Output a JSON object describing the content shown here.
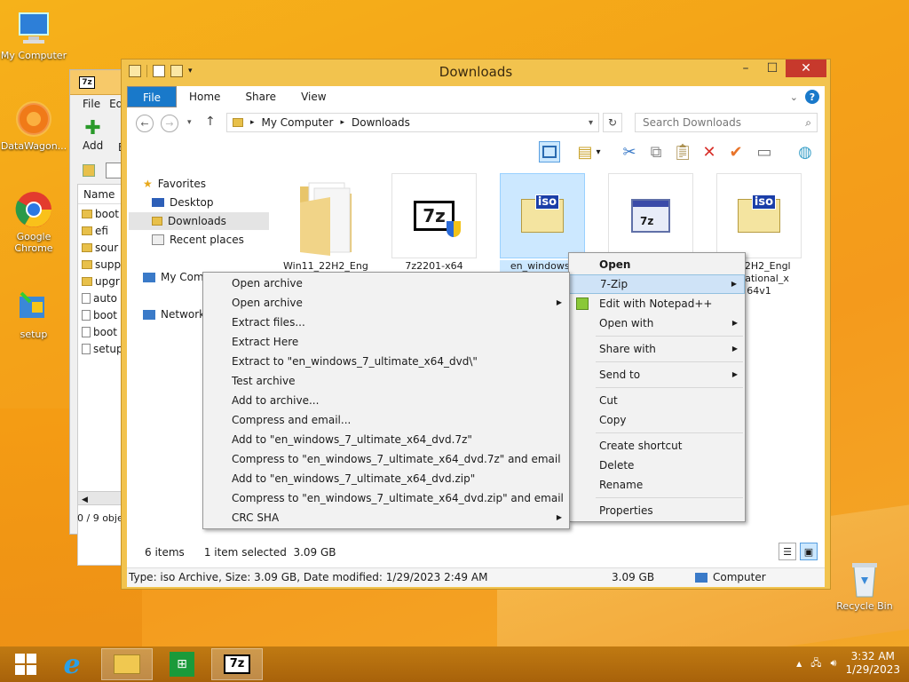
{
  "desktop": {
    "icons": [
      {
        "label": "My Computer"
      },
      {
        "label": "DataWagon..."
      },
      {
        "label": "Google Chrome"
      },
      {
        "label": "setup"
      },
      {
        "label": "Recycle Bin"
      }
    ]
  },
  "sevenzip_window": {
    "menu": [
      "File",
      "Ed"
    ],
    "toolbar_add": "Add",
    "toolbar_extra": "E",
    "column_name": "Name",
    "rows": [
      {
        "name": "boot",
        "kind": "folder"
      },
      {
        "name": "efi",
        "kind": "folder"
      },
      {
        "name": "sour",
        "kind": "folder"
      },
      {
        "name": "supp",
        "kind": "folder"
      },
      {
        "name": "upgr",
        "kind": "folder"
      },
      {
        "name": "auto",
        "kind": "file"
      },
      {
        "name": "boot",
        "kind": "file"
      },
      {
        "name": "boot",
        "kind": "file"
      },
      {
        "name": "setup",
        "kind": "file"
      }
    ],
    "status": "0 / 9 obje"
  },
  "explorer": {
    "title": "Downloads",
    "ribbon_tabs": [
      "File",
      "Home",
      "Share",
      "View"
    ],
    "breadcrumb": [
      "My Computer",
      "Downloads"
    ],
    "search_placeholder": "Search Downloads",
    "nav": {
      "favorites": "Favorites",
      "desktop": "Desktop",
      "downloads": "Downloads",
      "recent": "Recent places",
      "my_computer": "My Com",
      "network": "Network"
    },
    "files": [
      {
        "label": "Win11_22H2_Engl",
        "type": "folder"
      },
      {
        "label": "7z2201-x64",
        "type": "7z"
      },
      {
        "label": "en_windows_",
        "type": "iso",
        "selected": true
      },
      {
        "label": "",
        "type": "installer"
      },
      {
        "label": "1_22H2_Engl",
        "label2": "ernational_x",
        "label3": "64v1",
        "type": "iso"
      }
    ],
    "status_items": "6 items",
    "status_selected": "1 item selected  3.09 GB",
    "detail_text": "Type: iso Archive, Size: 3.09 GB, Date modified: 1/29/2023 2:49 AM",
    "detail_size": "3.09 GB",
    "detail_location": "Computer"
  },
  "context_menu": {
    "items": [
      {
        "label": "Open",
        "bold": true
      },
      {
        "label": "7-Zip",
        "submenu": true,
        "highlighted": true
      },
      {
        "label": "Edit with Notepad++"
      },
      {
        "label": "Open with",
        "submenu": true
      },
      {
        "label": "Share with",
        "submenu": true
      },
      {
        "label": "Send to",
        "submenu": true
      },
      {
        "label": "Cut"
      },
      {
        "label": "Copy"
      },
      {
        "label": "Create shortcut"
      },
      {
        "label": "Delete"
      },
      {
        "label": "Rename"
      },
      {
        "label": "Properties"
      }
    ]
  },
  "sevenzip_submenu": {
    "items": [
      "Open archive",
      "Open archive",
      "Extract files...",
      "Extract Here",
      "Extract to \"en_windows_7_ultimate_x64_dvd\\\"",
      "Test archive",
      "Add to archive...",
      "Compress and email...",
      "Add to \"en_windows_7_ultimate_x64_dvd.7z\"",
      "Compress to \"en_windows_7_ultimate_x64_dvd.7z\" and email",
      "Add to \"en_windows_7_ultimate_x64_dvd.zip\"",
      "Compress to \"en_windows_7_ultimate_x64_dvd.zip\" and email",
      "CRC SHA"
    ]
  },
  "taskbar": {
    "time": "3:32 AM",
    "date": "1/29/2023",
    "task_7z_label": "7z"
  },
  "colors": {
    "wallpaper": "#f4a218",
    "window_frame": "#f2c34e",
    "accent": "#1979ca",
    "close": "#c7392c",
    "highlight": "#cfe3f7"
  }
}
